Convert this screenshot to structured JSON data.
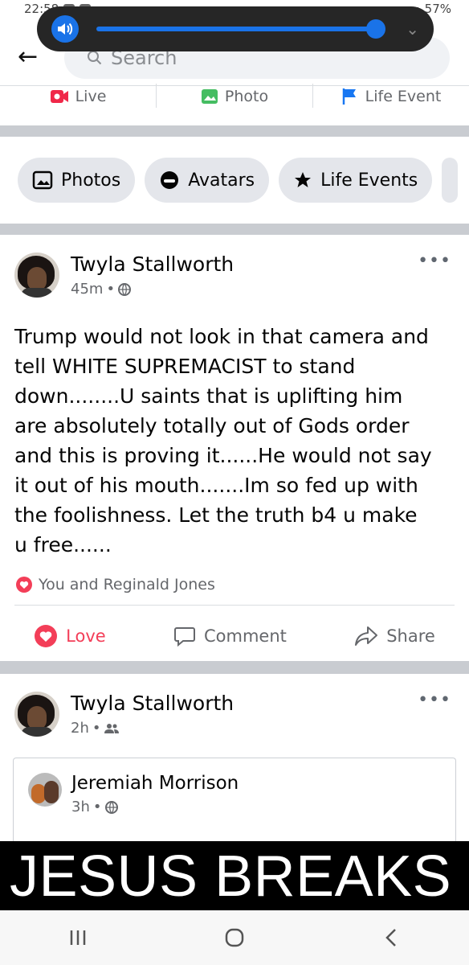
{
  "status_bar": {
    "time": "22:58",
    "battery": "57%"
  },
  "search": {
    "placeholder": "Search"
  },
  "composer": {
    "live": "Live",
    "photo": "Photo",
    "life_event": "Life Event"
  },
  "chips": [
    {
      "label": "Photos"
    },
    {
      "label": "Avatars"
    },
    {
      "label": "Life Events"
    }
  ],
  "post1": {
    "author": "Twyla Stallworth",
    "time": "45m",
    "lines": [
      "Trump would not look in that camera and",
      "tell WHITE SUPREMACIST to stand",
      "down........U saints that is uplifting him",
      "are absolutely totally out of Gods order",
      "and this is proving it......He would not say",
      "it out of his mouth.......Im so fed up with",
      "the foolishness. Let the truth b4 u make",
      "u free......"
    ],
    "reactions": "You and Reginald Jones",
    "actions": {
      "love": "Love",
      "comment": "Comment",
      "share": "Share"
    }
  },
  "post2": {
    "author": "Twyla Stallworth",
    "time": "2h",
    "shared": {
      "author": "Jeremiah Morrison",
      "time": "3h"
    },
    "image_text": "JESUS BREAKS"
  },
  "colors": {
    "love": "#f33e58",
    "accent": "#1a73e8",
    "meta": "#65676b",
    "band": "#c9ccd1"
  }
}
